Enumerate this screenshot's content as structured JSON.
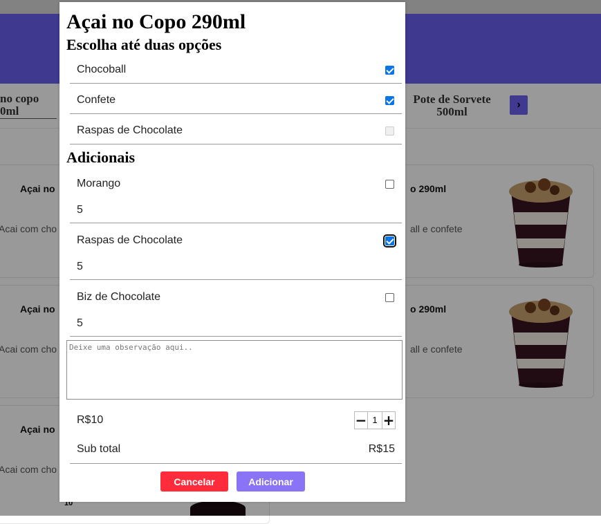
{
  "background": {
    "categories": {
      "left": "no copo\n0ml",
      "right": "Pote de Sorvete\n500ml"
    },
    "cards": [
      {
        "title_left": "Açai no",
        "desc_left": "Acai com cho",
        "title_right": "o 290ml",
        "desc_right": "all e confete"
      },
      {
        "title_left": "Açai no",
        "desc_left": "Acai com cho",
        "title_right": "o 290ml",
        "desc_right": "all e confete"
      },
      {
        "title_left": "Açai no",
        "desc_left": "Acai com cho"
      }
    ],
    "partial_price": "10"
  },
  "modal": {
    "title": "Açai no Copo 290ml",
    "choose_title": "Escolha até duas opções",
    "options": [
      {
        "label": "Chocoball",
        "state": "checked"
      },
      {
        "label": "Confete",
        "state": "checked"
      },
      {
        "label": "Raspas de Chocolate",
        "state": "disabled"
      }
    ],
    "additions_title": "Adicionais",
    "additions": [
      {
        "label": "Morango",
        "price": "5",
        "state": "unchecked"
      },
      {
        "label": "Raspas de Chocolate",
        "price": "5",
        "state": "checked"
      },
      {
        "label": "Biz de Chocolate",
        "price": "5",
        "state": "unchecked"
      }
    ],
    "observation_placeholder": "Deixe uma observação aqui..",
    "price": "R$10",
    "quantity": "1",
    "minus": "−",
    "plus": "+",
    "subtotal_label": "Sub total",
    "subtotal_value": "R$15",
    "cancel_label": "Cancelar",
    "add_label": "Adicionar"
  },
  "colors": {
    "header": "#6c5ff0",
    "cancel": "#ff2d3b",
    "add": "#8a73f5",
    "checkbox": "#0b74e6"
  }
}
